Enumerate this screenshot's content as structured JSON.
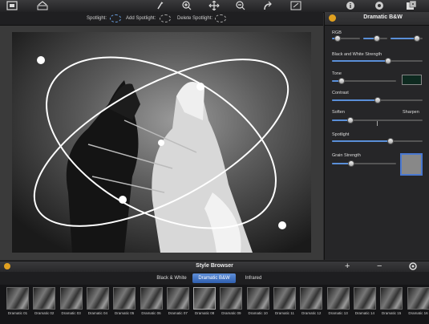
{
  "toolbar": {
    "icons": [
      "image-icon",
      "save-export-icon",
      "hand-icon",
      "zoom-in-icon",
      "move-icon",
      "zoom-out-icon",
      "redo-icon",
      "fit-screen-icon",
      "info-icon",
      "settings-icon",
      "dice-icon"
    ]
  },
  "spotlight_bar": {
    "spotlight_label": "Spotlight:",
    "add_label": "Add Spotlight:",
    "delete_label": "Delete Spotlight:"
  },
  "panel": {
    "title": "Dramatic B&W",
    "rgb_label": "RGB",
    "rgb_values": [
      0.2,
      0.55,
      0.83
    ],
    "bw_strength_label": "Black and White Strength",
    "bw_strength_value": 0.62,
    "tone_label": "Tone",
    "tone_value": 0.15,
    "tone_color": "#0e2a20",
    "contrast_label": "Contrast",
    "contrast_value": 0.5,
    "soften_label": "Soften",
    "sharpen_label": "Sharpen",
    "soften_value": 0.2,
    "spotlight_label": "Spotlight",
    "spotlight_value": 0.65,
    "grain_label": "Grain Strength",
    "grain_value": 0.3,
    "grain_color": "#888888"
  },
  "style_browser": {
    "title": "Style Browser",
    "add_symbol": "+",
    "remove_symbol": "−",
    "tabs": [
      {
        "label": "Black & White",
        "active": false
      },
      {
        "label": "Dramatic B&W",
        "active": true
      },
      {
        "label": "Infrared",
        "active": false
      }
    ],
    "thumbnails": [
      "Dramatic 01",
      "Dramatic 02",
      "Dramatic 03",
      "Dramatic 04",
      "Dramatic 05",
      "Dramatic 06",
      "Dramatic 07",
      "Dramatic 08",
      "Dramatic 09",
      "Dramatic 10",
      "Dramatic 11",
      "Dramatic 12",
      "Dramatic 13",
      "Dramatic 14",
      "Dramatic 15",
      "Dramatic 16"
    ]
  },
  "colors": {
    "accent": "#e0a020",
    "slider_fill": "#5a8fd8",
    "active_tab": "#3f6fc0"
  }
}
